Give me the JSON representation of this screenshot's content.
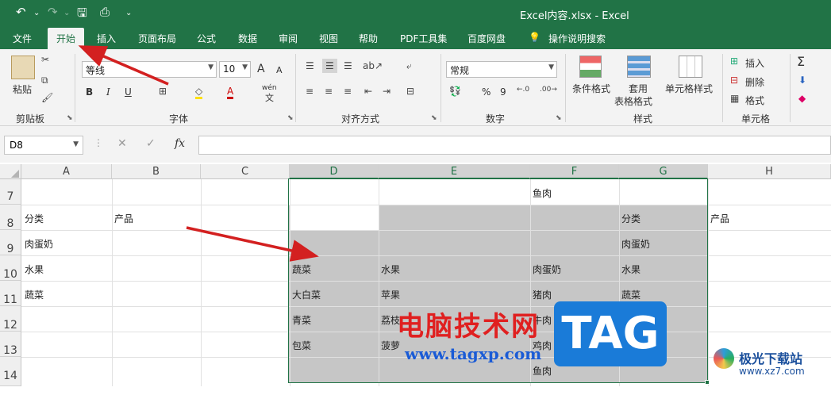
{
  "window": {
    "title": "Excel内容.xlsx  -  Excel"
  },
  "qat": {
    "undo": "↶",
    "redo": "↷",
    "save": "🖫",
    "preview": "⎙",
    "more": "⌄"
  },
  "tabs": [
    "文件",
    "开始",
    "插入",
    "页面布局",
    "公式",
    "数据",
    "审阅",
    "视图",
    "帮助",
    "PDF工具集",
    "百度网盘"
  ],
  "tell_me": "操作说明搜索",
  "ribbon": {
    "clipboard": {
      "paste": "粘贴",
      "label": "剪贴板"
    },
    "font": {
      "name": "等线",
      "size": "10",
      "bold": "B",
      "italic": "I",
      "underline": "U",
      "grow": "A",
      "shrink": "A",
      "label": "字体",
      "wen": "wén",
      "wen2": "文"
    },
    "alignment": {
      "label": "对齐方式"
    },
    "number": {
      "format": "常规",
      "label": "数字",
      "percent": "%",
      "comma": "9"
    },
    "styles": {
      "conditional": "条件格式",
      "table1": "套用",
      "table2": "表格格式",
      "cell": "单元格样式",
      "label": "样式"
    },
    "cells": {
      "insert": "插入",
      "delete": "删除",
      "format": "格式",
      "label": "单元格"
    },
    "editing": {
      "sum": "Σ"
    }
  },
  "formula_bar": {
    "name_box": "D8",
    "cancel": "✕",
    "enter": "✓",
    "fx": "fx",
    "value": ""
  },
  "columns": [
    "A",
    "B",
    "C",
    "D",
    "E",
    "F",
    "G",
    "H"
  ],
  "rows": [
    "7",
    "8",
    "9",
    "10",
    "11",
    "12",
    "13",
    "14"
  ],
  "cells": {
    "F7": "鱼肉",
    "A8": "分类",
    "B8": "产品",
    "G8": "分类",
    "H8": "产品",
    "A9": "肉蛋奶",
    "G9": "肉蛋奶",
    "A10": "水果",
    "D10": "蔬菜",
    "E10": "水果",
    "F10": "肉蛋奶",
    "G10": "水果",
    "A11": "蔬菜",
    "D11": "大白菜",
    "E11": "苹果",
    "F11": "猪肉",
    "G11": "蔬菜",
    "D12": "青菜",
    "E12": "荔枝",
    "F12": "牛肉",
    "D13": "包菜",
    "E13": "菠萝",
    "F13": "鸡肉",
    "F14": "鱼肉"
  },
  "watermark": {
    "line1": "电脑技术网",
    "line2": "www.tagxp.com",
    "tag": "TAG"
  },
  "site": {
    "name": "极光下载站",
    "url": "www.xz7.com"
  },
  "colors": {
    "accent": "#217346",
    "selection": "#c6c6c6",
    "arrow": "#d32020"
  }
}
